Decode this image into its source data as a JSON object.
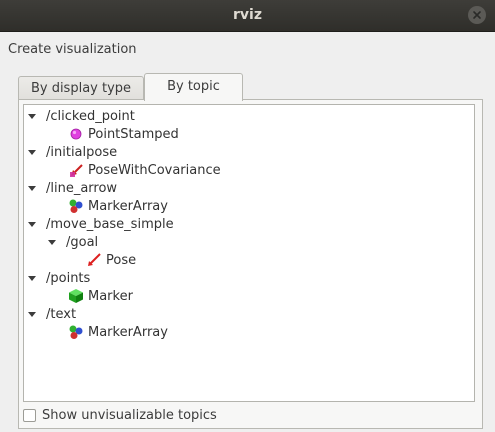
{
  "window": {
    "title": "rviz",
    "close_icon": "close-icon"
  },
  "dialog": {
    "section_label": "Create visualization",
    "tabs": [
      {
        "label": "By display type",
        "selected": false
      },
      {
        "label": "By topic",
        "selected": true
      }
    ],
    "tree": [
      {
        "topic": "/clicked_point",
        "children": [
          {
            "label": "PointStamped",
            "icon": "point-stamped-icon"
          }
        ]
      },
      {
        "topic": "/initialpose",
        "children": [
          {
            "label": "PoseWithCovariance",
            "icon": "pose-with-covariance-icon"
          }
        ]
      },
      {
        "topic": "/line_arrow",
        "children": [
          {
            "label": "MarkerArray",
            "icon": "marker-array-icon"
          }
        ]
      },
      {
        "topic": "/move_base_simple",
        "children": [
          {
            "topic": "/goal",
            "children": [
              {
                "label": "Pose",
                "icon": "pose-icon"
              }
            ]
          }
        ]
      },
      {
        "topic": "/points",
        "children": [
          {
            "label": "Marker",
            "icon": "marker-icon"
          }
        ]
      },
      {
        "topic": "/text",
        "children": [
          {
            "label": "MarkerArray",
            "icon": "marker-array-icon"
          }
        ]
      }
    ],
    "show_unvisualizable": {
      "label": "Show unvisualizable topics",
      "checked": false
    }
  }
}
